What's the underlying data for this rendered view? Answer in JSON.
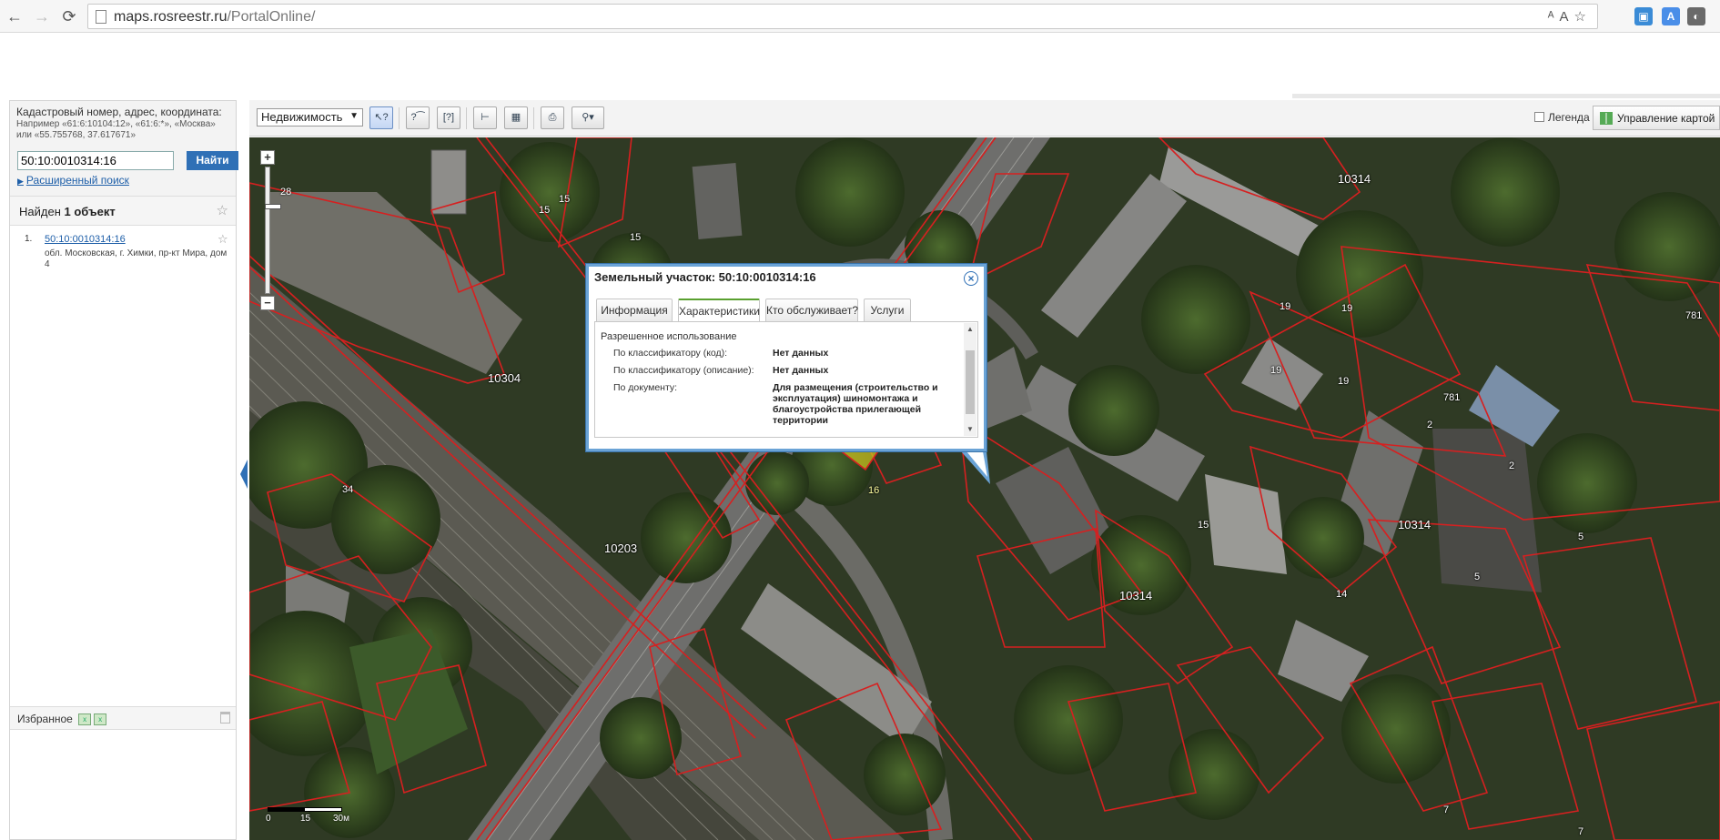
{
  "browser": {
    "url_host": "maps.rosreestr.ru",
    "url_path": "/PortalOnline/"
  },
  "search": {
    "label": "Кадастровый номер, адрес, координата:",
    "hint": "Например «61:6:10104:12», «61:6:*», «Москва» или «55.755768, 37.617671»",
    "value": "50:10:0010314:16",
    "find_label": "Найти",
    "advanced_label": "Расширенный поиск"
  },
  "results": {
    "header_prefix": "Найден ",
    "header_count": "1 объект",
    "items": [
      {
        "num": "1.",
        "link": "50:10:0010314:16",
        "address": "обл. Московская, г. Химки, пр-кт Мира, дом 4"
      }
    ]
  },
  "favorites": {
    "label": "Избранное"
  },
  "toolbar": {
    "layer": "Недвижимость",
    "legend_label": "Легенда",
    "map_control_label": "Управление картой"
  },
  "map": {
    "zoom_level": "28",
    "scale_labels": [
      "0",
      "15",
      "30м"
    ],
    "parcel_labels": [
      "10314",
      "10304",
      "10304",
      "10203",
      "10314",
      "10314",
      "15",
      "15",
      "19",
      "19",
      "19",
      "19",
      "781",
      "781",
      "34",
      "2",
      "2",
      "5",
      "5",
      "14",
      "7",
      "7",
      "15",
      "16",
      "15"
    ]
  },
  "popup": {
    "title": "Земельный участок: 50:10:0010314:16",
    "tabs": [
      "Информация",
      "Характеристики",
      "Кто обслуживает?",
      "Услуги"
    ],
    "active_tab": "Характеристики",
    "section": "Разрешенное использование",
    "props": [
      {
        "label": "По классификатору (код):",
        "value": "Нет данных"
      },
      {
        "label": "По классификатору (описание):",
        "value": "Нет данных"
      },
      {
        "label": "По документу:",
        "value": "Для размещения (строительство и эксплуатация) шиномонтажа и благоустройства прилегающей территории"
      }
    ]
  },
  "colors": {
    "parcel_border": "#d62020",
    "highlight_fill": "#c8c020",
    "accent": "#2f70b6"
  }
}
